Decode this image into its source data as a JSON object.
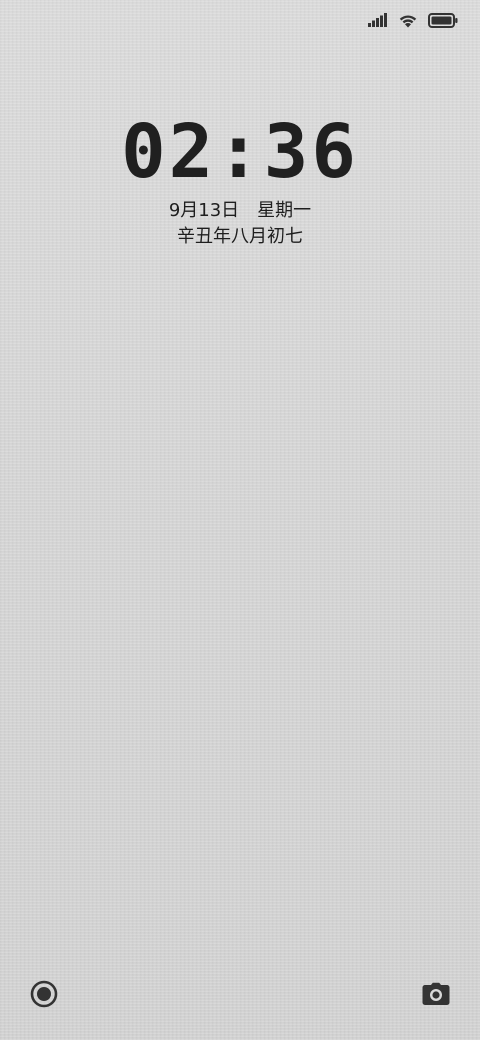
{
  "status_bar": {
    "signal_icon": "signal-bars-icon",
    "wifi_icon": "wifi-icon",
    "battery_icon": "battery-full-icon"
  },
  "lock_screen": {
    "time": "02:36",
    "date": "9月13日",
    "weekday": "星期一",
    "lunar_date": "辛丑年八月初七"
  },
  "shortcuts": {
    "left_icon": "assistant-ring-icon",
    "right_icon": "camera-icon"
  },
  "colors": {
    "text": "#1f1f1f",
    "icon": "#333333",
    "background": "#d9d9d9"
  }
}
